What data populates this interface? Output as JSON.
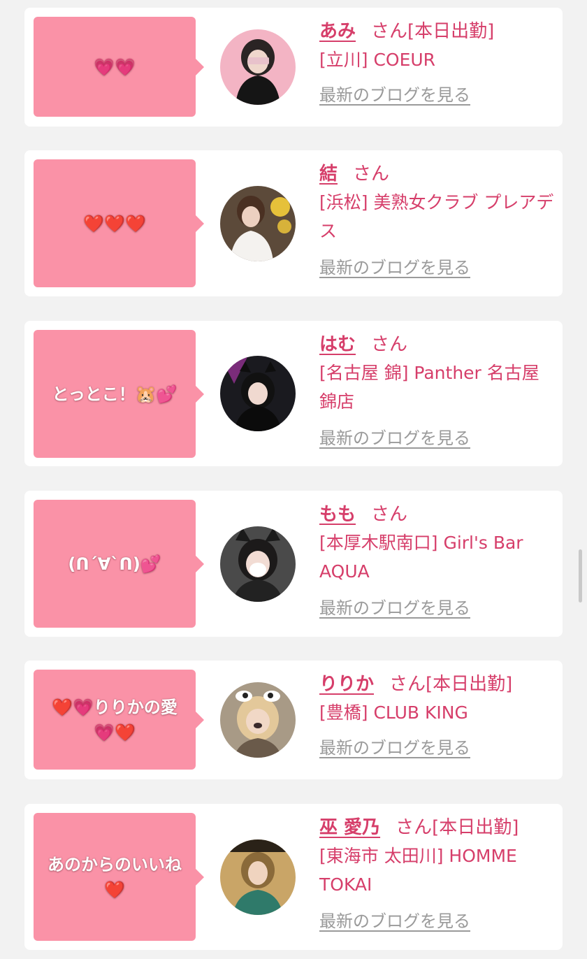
{
  "blog_link_label": "最新のブログを見る",
  "san_label": "さん",
  "entries": [
    {
      "bubble": "💗💗",
      "name": "あみ",
      "status": "[本日出勤]",
      "store": "[立川] COEUR"
    },
    {
      "bubble": "❤️❤️❤️",
      "name": "結",
      "status": "",
      "store": "[浜松] 美熟女クラブ プレアデス"
    },
    {
      "bubble": "とっとこ！🐹💕",
      "name": "はむ",
      "status": "",
      "store": "[名古屋 錦] Panther 名古屋錦店"
    },
    {
      "bubble": "(ᑎ´∀`ᑎ)💕",
      "name": "もも",
      "status": "",
      "store": "[本厚木駅南口] Girl's Bar AQUA"
    },
    {
      "bubble": "❤️💗りりかの愛💗❤️",
      "name": "りりか",
      "status": "[本日出勤]",
      "store": "[豊橋] CLUB KING"
    },
    {
      "bubble": "あのからのいいね❤️",
      "name": "巫 愛乃",
      "status": "[本日出勤]",
      "store": "[東海市 太田川] HOMME TOKAI"
    }
  ],
  "colors": {
    "page_bg": "#f2f2f2",
    "bubble_bg": "#fa92a7",
    "accent_text": "#d63e6a",
    "link_gray": "#9a9a9a"
  }
}
